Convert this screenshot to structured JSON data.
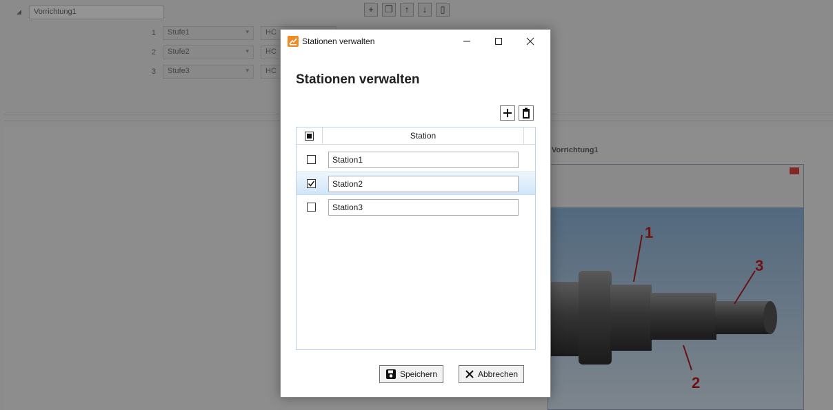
{
  "background": {
    "tree_field_value": "Vorrichtung1",
    "steps": [
      {
        "num": "1",
        "name": "Stufe1",
        "mode": "HC"
      },
      {
        "num": "2",
        "name": "Stufe2",
        "mode": "HC"
      },
      {
        "num": "3",
        "name": "Stufe3",
        "mode": "HC"
      }
    ],
    "preview_title": "Vorrichtung1",
    "callouts": [
      "1",
      "2",
      "3"
    ]
  },
  "dialog": {
    "title": "Stationen verwalten",
    "heading": "Stationen verwalten",
    "window_controls": {
      "minimize": "–",
      "maximize": "☐",
      "close": "✕"
    },
    "column_header": "Station",
    "header_checkbox_state": "indeterminate",
    "rows": [
      {
        "name": "Station1",
        "checked": false,
        "selected": false
      },
      {
        "name": "Station2",
        "checked": true,
        "selected": true
      },
      {
        "name": "Station3",
        "checked": false,
        "selected": false
      }
    ],
    "buttons": {
      "save": "Speichern",
      "cancel": "Abbrechen"
    }
  },
  "icons": {
    "add": "plus-icon",
    "delete": "trash-icon",
    "save": "floppy-disk-icon",
    "cancel": "x-icon",
    "app": "app-logo-icon"
  },
  "colors": {
    "accent": "#f08a24",
    "selection": "#cfe6f9",
    "grid_border": "#b9d1ea"
  }
}
